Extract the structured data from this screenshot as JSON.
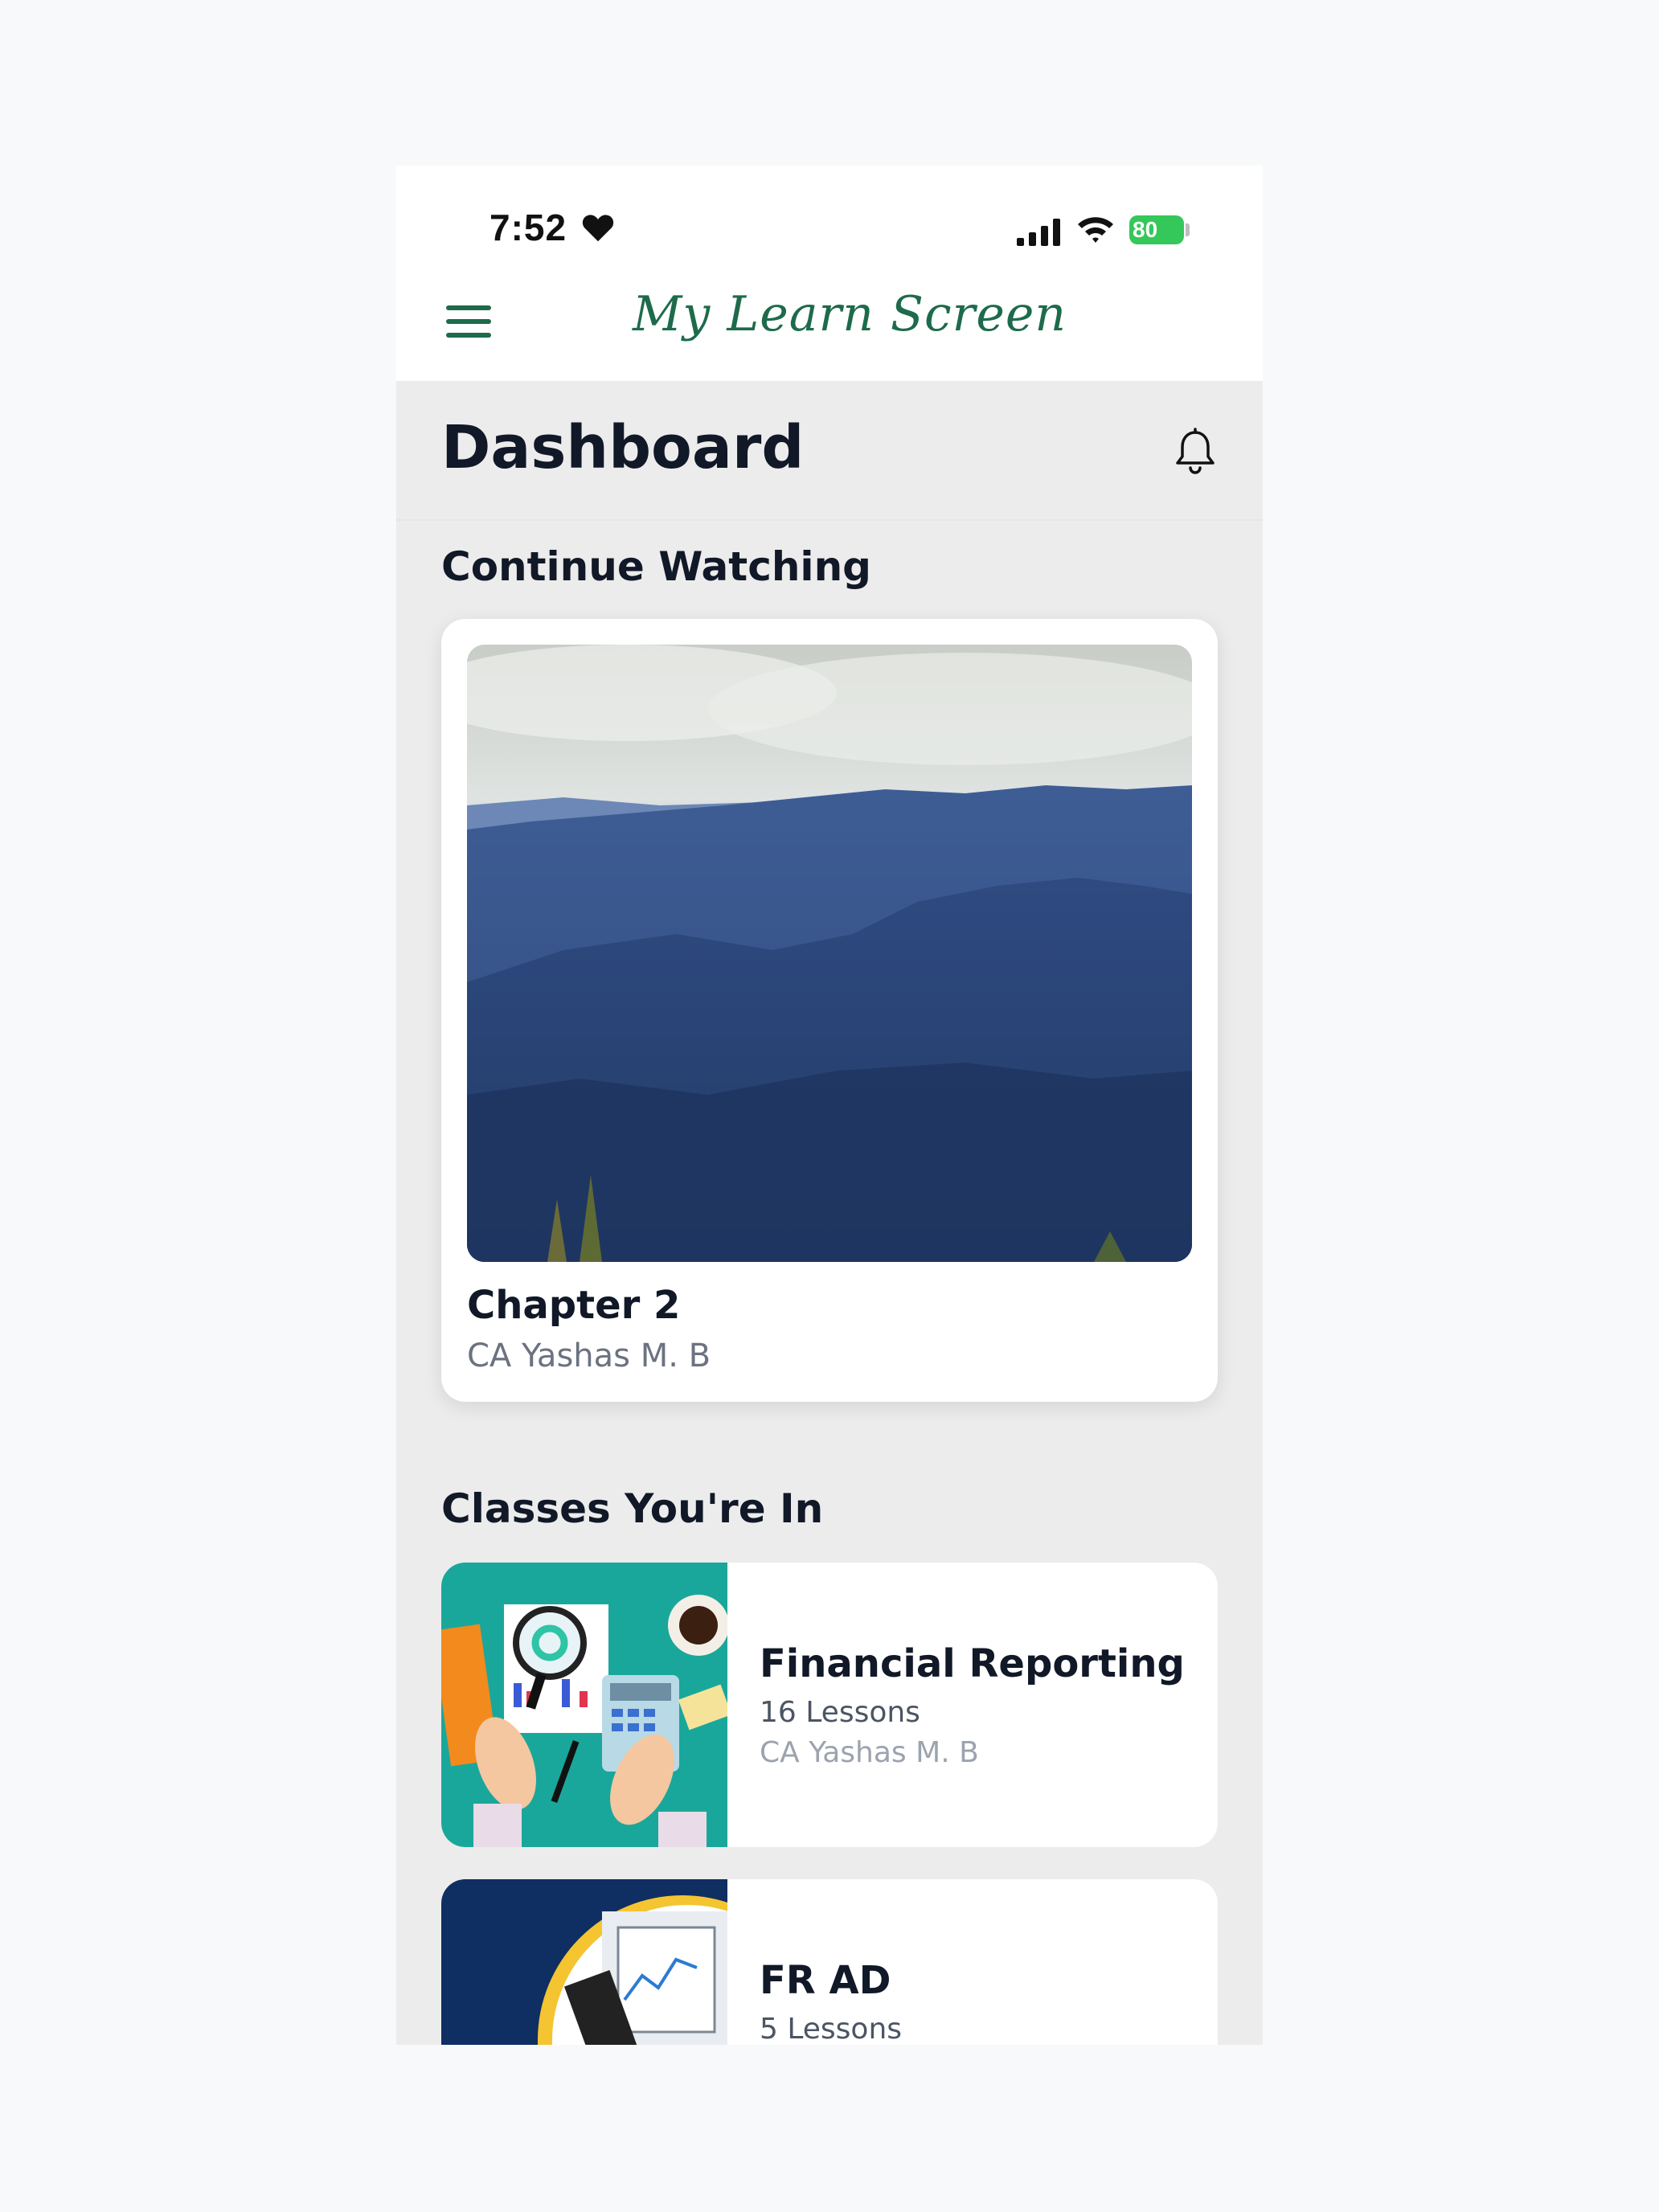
{
  "status_bar": {
    "time": "7:52",
    "battery": "80",
    "battery_color": "#34c759"
  },
  "header": {
    "app_title": "My Learn Screen",
    "menu_icon": "hamburger-menu-icon",
    "title_color": "#1d6b4b"
  },
  "dashboard": {
    "title": "Dashboard",
    "notification_icon": "bell-icon"
  },
  "continue_watching": {
    "section_title": "Continue Watching",
    "item": {
      "title": "Chapter 2",
      "author": "CA Yashas M. B"
    }
  },
  "classes": {
    "section_title": "Classes You're In",
    "items": [
      {
        "name": "Financial Reporting",
        "lessons": "16 Lessons",
        "author": "CA Yashas M. B"
      },
      {
        "name": "FR AD",
        "lessons": "5 Lessons"
      }
    ]
  }
}
